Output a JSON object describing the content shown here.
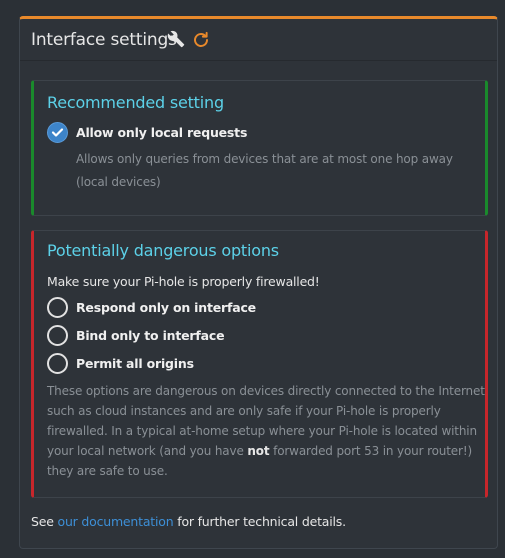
{
  "panel": {
    "title": "Interface settings"
  },
  "recommended": {
    "title": "Recommended setting",
    "option_label": "Allow only local requests",
    "checked": true,
    "description": "Allows only queries from devices that are at most one hop away (local devices)"
  },
  "dangerous": {
    "title": "Potentially dangerous options",
    "warning": "Make sure your Pi-hole is properly firewalled!",
    "options": [
      {
        "label": "Respond only on interface",
        "checked": false
      },
      {
        "label": "Bind only to interface",
        "checked": false
      },
      {
        "label": "Permit all origins",
        "checked": false
      }
    ],
    "description_before": "These options are dangerous on devices directly connected to the Internet such as cloud instances and are only safe if your Pi-hole is properly firewalled. In a typical at-home setup where your Pi-hole is located within your local network (and you have ",
    "description_bold": "not",
    "description_after": " forwarded port 53 in your router!) they are safe to use."
  },
  "footer": {
    "prefix": "See ",
    "link_text": "our documentation",
    "suffix": " for further technical details."
  },
  "colors": {
    "accent_top": "#e8892b",
    "title_cyan": "#5cd1e8",
    "green_border": "#1a8a2c",
    "red_border": "#c7262b",
    "link": "#3d8fd6",
    "checkbox": "#3d84c9"
  },
  "icons": {
    "header_wrench": "wrench-icon",
    "header_refresh": "refresh-icon",
    "checked": "check-icon"
  }
}
